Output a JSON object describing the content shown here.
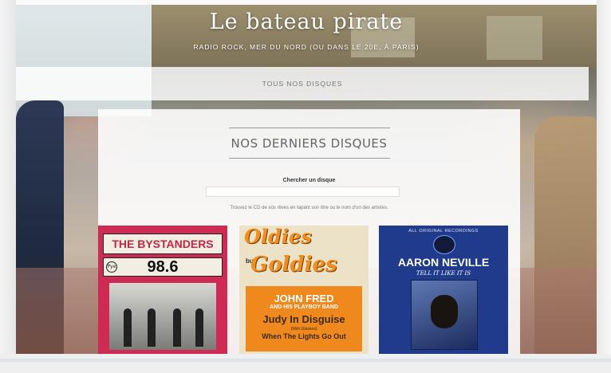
{
  "site": {
    "title": "Le bateau pirate",
    "tagline": "RADIO ROCK, MER DU NORD (OU DANS LE 20E, À PARIS)"
  },
  "nav": {
    "items": [
      {
        "label": "TOUS NOS DISQUES"
      }
    ]
  },
  "main": {
    "section_title": "NOS DERNIERS DISQUES",
    "search": {
      "label": "Chercher un disque",
      "value": "",
      "help": "Trouvez le CD de vos rêves en tapant son titre ou le nom d'un des artistes."
    },
    "albums": [
      {
        "band": "THE BYSTANDERS",
        "number": "98.6",
        "logo_text": "Pye"
      },
      {
        "heading_1": "Oldies",
        "heading_mid": "but",
        "heading_2": "Goldies",
        "artist": "JOHN FRED",
        "band": "AND HIS PLAYBOY BAND",
        "title": "Judy In Disguise",
        "credit": "(With Glasses)",
        "b_side": "When The Lights Go Out"
      },
      {
        "top_text": "ALL ORIGINAL RECORDINGS",
        "artist": "AARON NEVILLE",
        "song": "TELL IT LIKE IT IS"
      }
    ]
  }
}
